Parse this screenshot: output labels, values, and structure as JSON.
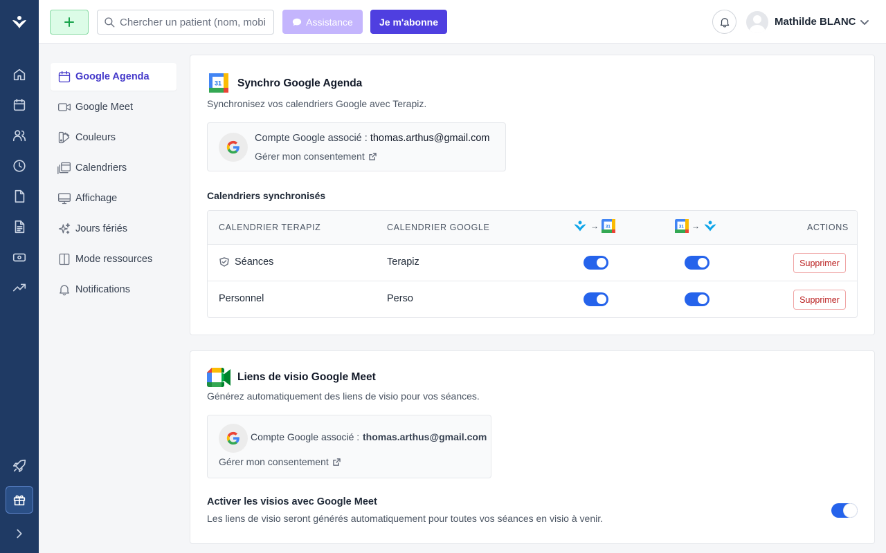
{
  "rail": {
    "icons": [
      "terapiz-logo",
      "home-icon",
      "calendar-icon",
      "users-icon",
      "clock-icon",
      "file-icon",
      "document-icon",
      "money-icon",
      "trending-icon",
      "rocket-icon",
      "gift-icon",
      "chevron-right-icon"
    ]
  },
  "topbar": {
    "search_placeholder": "Chercher un patient (nom, mobile…)",
    "assistance_label": "Assistance",
    "subscribe_label": "Je m'abonne",
    "user_name": "Mathilde BLANC"
  },
  "menu": {
    "items": [
      {
        "label": "Google Agenda",
        "icon": "calendar-icon",
        "active": true
      },
      {
        "label": "Google Meet",
        "icon": "video-icon",
        "active": false
      },
      {
        "label": "Couleurs",
        "icon": "palette-icon",
        "active": false
      },
      {
        "label": "Calendriers",
        "icon": "calendars-icon",
        "active": false
      },
      {
        "label": "Affichage",
        "icon": "monitor-icon",
        "active": false
      },
      {
        "label": "Jours fériés",
        "icon": "sparkles-icon",
        "active": false
      },
      {
        "label": "Mode ressources",
        "icon": "columns-icon",
        "active": false
      },
      {
        "label": "Notifications",
        "icon": "bell-icon",
        "active": false
      }
    ]
  },
  "sync": {
    "title": "Synchro Google Agenda",
    "description": "Synchronisez vos calendriers Google avec Terapiz.",
    "account_label": "Compte Google associé : ",
    "account_email": "thomas.arthus@gmail.com",
    "consent_link": "Gérer mon consentement",
    "section_label": "Calendriers synchronisés",
    "columns": {
      "terapiz": "CALENDRIER TERAPIZ",
      "google": "CALENDRIER GOOGLE",
      "actions": "ACTIONS"
    },
    "rows": [
      {
        "terapiz": "Séances",
        "google": "Terapiz",
        "to_google": true,
        "to_terapiz": true,
        "action": "Supprimer",
        "has_icon": true
      },
      {
        "terapiz": "Personnel",
        "google": "Perso",
        "to_google": true,
        "to_terapiz": true,
        "action": "Supprimer",
        "has_icon": false
      }
    ]
  },
  "meet": {
    "title": "Liens de visio Google Meet",
    "description": "Générez automatiquement des liens de visio pour vos séances.",
    "account_label": "Compte Google associé :",
    "account_email": "thomas.arthus@gmail.com",
    "consent_link": "Gérer mon consentement",
    "activate_title": "Activer les visios avec Google Meet",
    "activate_desc": "Les liens de visio seront générés automatiquement pour toutes vos séances en visio à venir.",
    "activate_enabled": true
  },
  "colors": {
    "rail_bg": "#1f3a64",
    "accent": "#4f3fe0",
    "toggle_on": "#2563eb",
    "danger": "#b91c1c"
  }
}
